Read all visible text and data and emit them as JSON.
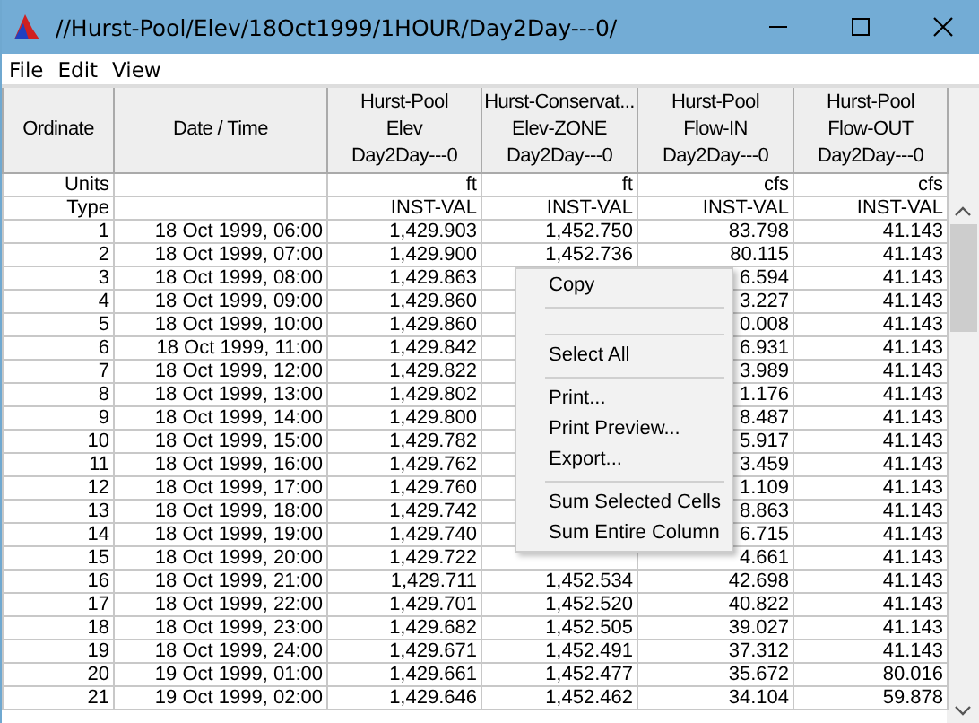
{
  "window": {
    "title": "//Hurst-Pool/Elev/18Oct1999/1HOUR/Day2Day---0/"
  },
  "menu_bar": [
    "File",
    "Edit",
    "View"
  ],
  "table": {
    "columns": [
      {
        "lines": [
          "Ordinate"
        ]
      },
      {
        "lines": [
          "Date / Time"
        ]
      },
      {
        "lines": [
          "Hurst-Pool",
          "Elev",
          "Day2Day---0"
        ]
      },
      {
        "lines": [
          "Hurst-Conservat...",
          "Elev-ZONE",
          "Day2Day---0"
        ]
      },
      {
        "lines": [
          "Hurst-Pool",
          "Flow-IN",
          "Day2Day---0"
        ]
      },
      {
        "lines": [
          "Hurst-Pool",
          "Flow-OUT",
          "Day2Day---0"
        ]
      }
    ],
    "meta_rows": [
      {
        "label": "Units",
        "cells": [
          "",
          "ft",
          "ft",
          "cfs",
          "cfs"
        ]
      },
      {
        "label": "Type",
        "cells": [
          "",
          "INST-VAL",
          "INST-VAL",
          "INST-VAL",
          "INST-VAL"
        ]
      }
    ],
    "rows": [
      [
        "1",
        "18 Oct 1999, 06:00",
        "1,429.903",
        "1,452.750",
        "83.798",
        "41.143"
      ],
      [
        "2",
        "18 Oct 1999, 07:00",
        "1,429.900",
        "1,452.736",
        "80.115",
        "41.143"
      ],
      [
        "3",
        "18 Oct 1999, 08:00",
        "1,429.863",
        null,
        "6.594",
        "41.143"
      ],
      [
        "4",
        "18 Oct 1999, 09:00",
        "1,429.860",
        null,
        "3.227",
        "41.143"
      ],
      [
        "5",
        "18 Oct 1999, 10:00",
        "1,429.860",
        null,
        "0.008",
        "41.143"
      ],
      [
        "6",
        "18 Oct 1999, 11:00",
        "1,429.842",
        null,
        "6.931",
        "41.143"
      ],
      [
        "7",
        "18 Oct 1999, 12:00",
        "1,429.822",
        null,
        "3.989",
        "41.143"
      ],
      [
        "8",
        "18 Oct 1999, 13:00",
        "1,429.802",
        null,
        "1.176",
        "41.143"
      ],
      [
        "9",
        "18 Oct 1999, 14:00",
        "1,429.800",
        null,
        "8.487",
        "41.143"
      ],
      [
        "10",
        "18 Oct 1999, 15:00",
        "1,429.782",
        null,
        "5.917",
        "41.143"
      ],
      [
        "11",
        "18 Oct 1999, 16:00",
        "1,429.762",
        null,
        "3.459",
        "41.143"
      ],
      [
        "12",
        "18 Oct 1999, 17:00",
        "1,429.760",
        null,
        "1.109",
        "41.143"
      ],
      [
        "13",
        "18 Oct 1999, 18:00",
        "1,429.742",
        null,
        "8.863",
        "41.143"
      ],
      [
        "14",
        "18 Oct 1999, 19:00",
        "1,429.740",
        null,
        "6.715",
        "41.143"
      ],
      [
        "15",
        "18 Oct 1999, 20:00",
        "1,429.722",
        null,
        "4.661",
        "41.143"
      ],
      [
        "16",
        "18 Oct 1999, 21:00",
        "1,429.711",
        "1,452.534",
        "42.698",
        "41.143"
      ],
      [
        "17",
        "18 Oct 1999, 22:00",
        "1,429.701",
        "1,452.520",
        "40.822",
        "41.143"
      ],
      [
        "18",
        "18 Oct 1999, 23:00",
        "1,429.682",
        "1,452.505",
        "39.027",
        "41.143"
      ],
      [
        "19",
        "18 Oct 1999, 24:00",
        "1,429.671",
        "1,452.491",
        "37.312",
        "41.143"
      ],
      [
        "20",
        "19 Oct 1999, 01:00",
        "1,429.661",
        "1,452.477",
        "35.672",
        "80.016"
      ],
      [
        "21",
        "19 Oct 1999, 02:00",
        "1,429.646",
        "1,452.462",
        "34.104",
        "59.878"
      ]
    ]
  },
  "context_menu": [
    {
      "kind": "item",
      "label": "Copy"
    },
    {
      "kind": "separator"
    },
    {
      "kind": "gap"
    },
    {
      "kind": "separator"
    },
    {
      "kind": "item",
      "label": "Select All"
    },
    {
      "kind": "separator"
    },
    {
      "kind": "item",
      "label": "Print..."
    },
    {
      "kind": "item",
      "label": "Print Preview..."
    },
    {
      "kind": "item",
      "label": "Export..."
    },
    {
      "kind": "separator"
    },
    {
      "kind": "item",
      "label": "Sum Selected Cells"
    },
    {
      "kind": "item",
      "label": "Sum Entire Column"
    }
  ]
}
